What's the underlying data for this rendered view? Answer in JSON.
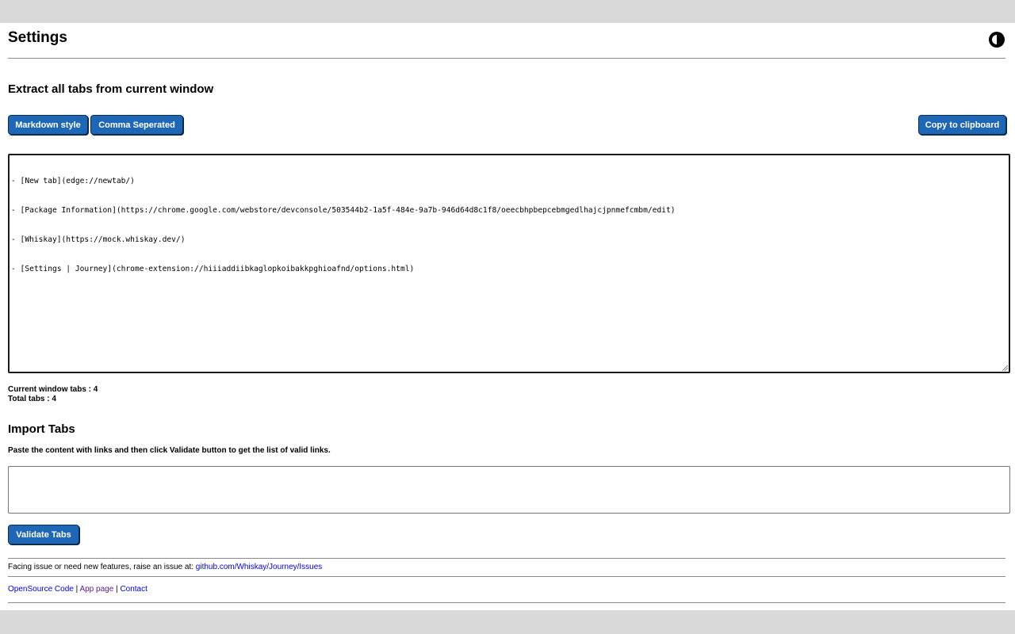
{
  "header": {
    "title": "Settings",
    "theme_icon": "contrast-icon"
  },
  "extract": {
    "heading": "Extract all tabs from current window",
    "buttons": {
      "markdown": "Markdown style",
      "comma": "Comma Seperated",
      "copy": "Copy to clipboard"
    },
    "lines": [
      "- [New tab](edge://newtab/)",
      "- [Package Information](https://chrome.google.com/webstore/devconsole/503544b2-1a5f-484e-9a7b-946d64d8c1f8/oeecbhpbepcebmgedlhajcjpnmefcmbm/edit)",
      "- [Whiskay](https://mock.whiskay.dev/)",
      "- [Settings | Journey](chrome-extension://hiiiaddiibkaglopkoibakkpghioafnd/options.html)"
    ],
    "current_window_tabs": "Current window tabs : 4",
    "total_tabs": "Total tabs : 4"
  },
  "import": {
    "heading": "Import Tabs",
    "hint": "Paste the content with links and then click Validate button to get the list of valid links.",
    "value": "",
    "validate_button": "Validate Tabs"
  },
  "footer": {
    "issue_text": "Facing issue or need new features, raise an issue at: ",
    "issue_link": "github.com/Whiskay/Journey/Issues",
    "links": {
      "opensource": "OpenSource Code",
      "app_page": "App page",
      "contact": "Contact",
      "separator": " | "
    }
  },
  "colors": {
    "button_bg": "#1e67b7",
    "link": "#0000ee",
    "visited_link": "#551a8b",
    "page_bg": "#ffffff",
    "outer_bg": "#d9d9d9"
  }
}
